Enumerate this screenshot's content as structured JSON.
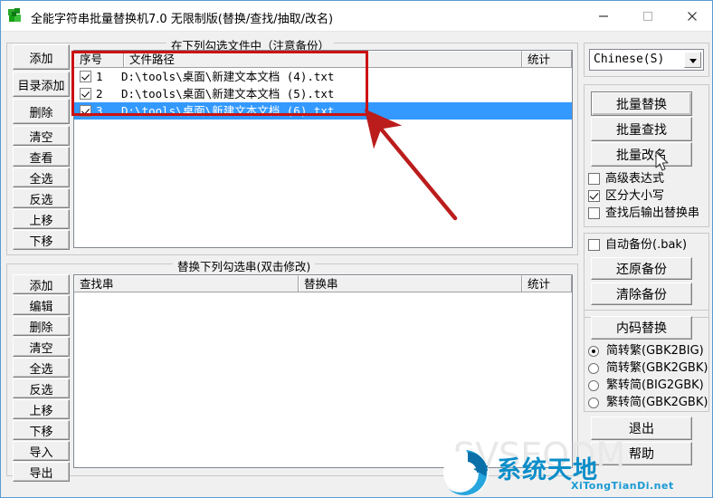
{
  "window": {
    "title": "全能字符串批量替换机7.0 无限制版(替换/查找/抽取/改名)",
    "icon": "app-green-icon",
    "minimize_label": "—",
    "maximize_label": "□",
    "close_label": "✕"
  },
  "file_group": {
    "title": "在下列勾选文件中（注意备份）",
    "buttons": [
      {
        "label": "添加"
      },
      {
        "label": "目录添加"
      },
      {
        "label": "删除"
      },
      {
        "label": "清空"
      },
      {
        "label": "查看"
      },
      {
        "label": "全选"
      },
      {
        "label": "反选"
      },
      {
        "label": "上移"
      },
      {
        "label": "下移"
      }
    ],
    "columns": [
      "序号",
      "文件路径",
      "统计"
    ],
    "rows": [
      {
        "checked": true,
        "index": "1",
        "path": "D:\\tools\\桌面\\新建文本文档 (4).txt",
        "stat": "",
        "selected": false
      },
      {
        "checked": true,
        "index": "2",
        "path": "D:\\tools\\桌面\\新建文本文档 (5).txt",
        "stat": "",
        "selected": false
      },
      {
        "checked": true,
        "index": "3",
        "path": "D:\\tools\\桌面\\新建文本文档 (6).txt",
        "stat": "",
        "selected": true
      }
    ]
  },
  "string_group": {
    "title": "替换下列勾选串(双击修改)",
    "buttons": [
      {
        "label": "添加"
      },
      {
        "label": "编辑"
      },
      {
        "label": "删除"
      },
      {
        "label": "清空"
      },
      {
        "label": "全选"
      },
      {
        "label": "反选"
      },
      {
        "label": "上移"
      },
      {
        "label": "下移"
      },
      {
        "label": "导入"
      },
      {
        "label": "导出"
      }
    ],
    "columns": [
      "查找串",
      "替换串",
      "统计"
    ],
    "rows": []
  },
  "right_panel": {
    "language": {
      "value": "Chinese(S)",
      "options": [
        "Chinese(S)"
      ]
    },
    "actions": [
      {
        "label": "批量替换",
        "default": true
      },
      {
        "label": "批量查找",
        "default": false
      },
      {
        "label": "批量改名",
        "default": false
      }
    ],
    "options": [
      {
        "label": "高级表达式",
        "checked": false
      },
      {
        "label": "区分大小写",
        "checked": true
      },
      {
        "label": "查找后输出替换串",
        "checked": false
      }
    ],
    "backup": {
      "auto_label": "自动备份(.bak)",
      "auto_checked": false,
      "restore_label": "还原备份",
      "clear_label": "清除备份"
    },
    "encoding": {
      "button_label": "内码替换",
      "radios": [
        {
          "label": "简转繁(GBK2BIG)",
          "checked": true
        },
        {
          "label": "简转繁(GBK2GBK)",
          "checked": false
        },
        {
          "label": "繁转简(BIG2GBK)",
          "checked": false
        },
        {
          "label": "繁转简(GBK2GBK)",
          "checked": false
        }
      ]
    },
    "exit_label": "退出",
    "help_label": "帮助"
  },
  "watermark": {
    "brand": "系统天地",
    "url": "XiTongTianDi.net",
    "ghost": "SVSEODM"
  },
  "annotation": {
    "box_color": "#cc1111",
    "arrow_color": "#bb1c1c"
  }
}
